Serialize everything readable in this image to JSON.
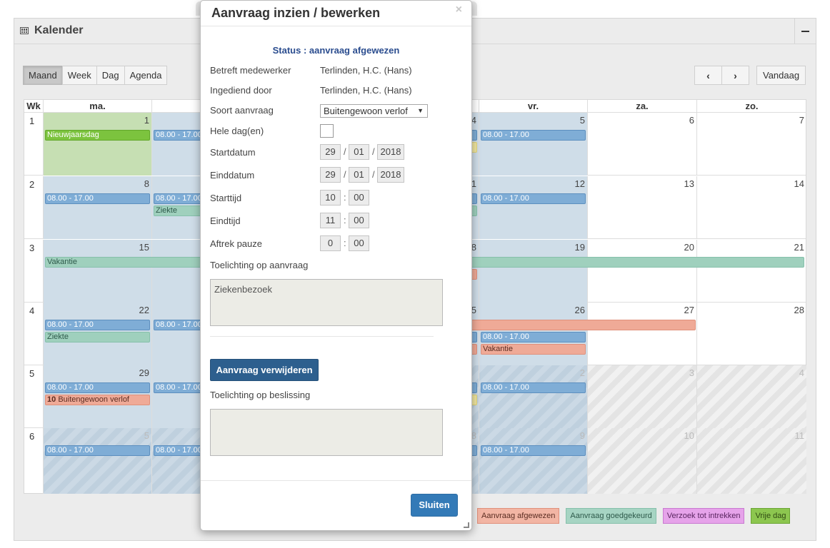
{
  "panel": {
    "title": "Kalender",
    "views": [
      "Maand",
      "Week",
      "Dag",
      "Agenda"
    ],
    "active_view": "Maand",
    "prev_icon": "chevron-left-icon",
    "next_icon": "chevron-right-icon",
    "today_label": "Vandaag"
  },
  "calendar": {
    "headers": [
      "Wk",
      "ma.",
      "",
      "",
      "",
      "vr.",
      "za.",
      "zo."
    ],
    "weeks": [
      "1",
      "2",
      "3",
      "4",
      "5",
      "6"
    ],
    "days": [
      [
        "1",
        "",
        "",
        "4",
        "5",
        "6",
        "7"
      ],
      [
        "8",
        "",
        "",
        "1",
        "12",
        "13",
        "14"
      ],
      [
        "15",
        "",
        "",
        "8",
        "19",
        "20",
        "21"
      ],
      [
        "22",
        "",
        "",
        "5",
        "26",
        "27",
        "28"
      ],
      [
        "29",
        "",
        "",
        "",
        "2",
        "3",
        "4"
      ],
      [
        "5",
        "",
        "",
        "8",
        "9",
        "10",
        "11"
      ]
    ],
    "events": {
      "holiday": "Nieuwjaarsdag",
      "shift": "08.00 - 17.00",
      "sick": "Ziekte",
      "vacation": "Vakantie",
      "special_leave_hour": "10",
      "special_leave": "Buitengewoon verlof"
    }
  },
  "legend": [
    "Aanvraag afgewezen",
    "Aanvraag goedgekeurd",
    "Verzoek tot intrekken",
    "Vrije dag"
  ],
  "modal": {
    "title": "Aanvraag inzien / bewerken",
    "close_glyph": "×",
    "status": "Status : aanvraag afgewezen",
    "fields": {
      "employee_label": "Betreft medewerker",
      "employee_value": "Terlinden, H.C. (Hans)",
      "submitted_label": "Ingediend door",
      "submitted_value": "Terlinden, H.C. (Hans)",
      "type_label": "Soort aanvraag",
      "type_value": "Buitengewoon verlof",
      "fullday_label": "Hele dag(en)",
      "start_date_label": "Startdatum",
      "start_date": {
        "day": "29",
        "month": "01",
        "year": "2018"
      },
      "end_date_label": "Einddatum",
      "end_date": {
        "day": "29",
        "month": "01",
        "year": "2018"
      },
      "start_time_label": "Starttijd",
      "start_time": {
        "h": "10",
        "m": "00"
      },
      "end_time_label": "Eindtijd",
      "end_time": {
        "h": "11",
        "m": "00"
      },
      "break_label": "Aftrek pauze",
      "break_time": {
        "h": "0",
        "m": "00"
      },
      "note_label": "Toelichting op aanvraag",
      "note_value": "Ziekenbezoek",
      "decision_label": "Toelichting op beslissing",
      "decision_value": ""
    },
    "delete_button": "Aanvraag verwijderen",
    "close_button": "Sluiten"
  }
}
